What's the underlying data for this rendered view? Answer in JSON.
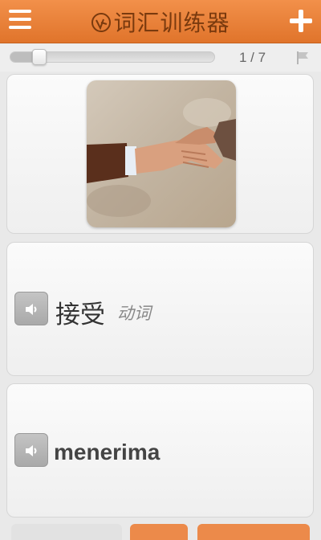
{
  "header": {
    "title": "词汇训练器",
    "menu_icon": "hamburger-menu-icon",
    "add_icon": "plus-icon",
    "background": "#e6793a"
  },
  "progress": {
    "current": 1,
    "total": 7,
    "label": "1 / 7",
    "fraction": 0.14
  },
  "image_card": {
    "subject": "handshake-photo"
  },
  "word_card": {
    "word": "接受",
    "part_of_speech": "动词",
    "audio_icon": "speaker-icon"
  },
  "translation_card": {
    "text": "menerima",
    "audio_icon": "speaker-icon"
  },
  "colors": {
    "accent": "#e6793a",
    "title_text": "#7a3a0e",
    "card_bg": "#f5f5f5"
  }
}
